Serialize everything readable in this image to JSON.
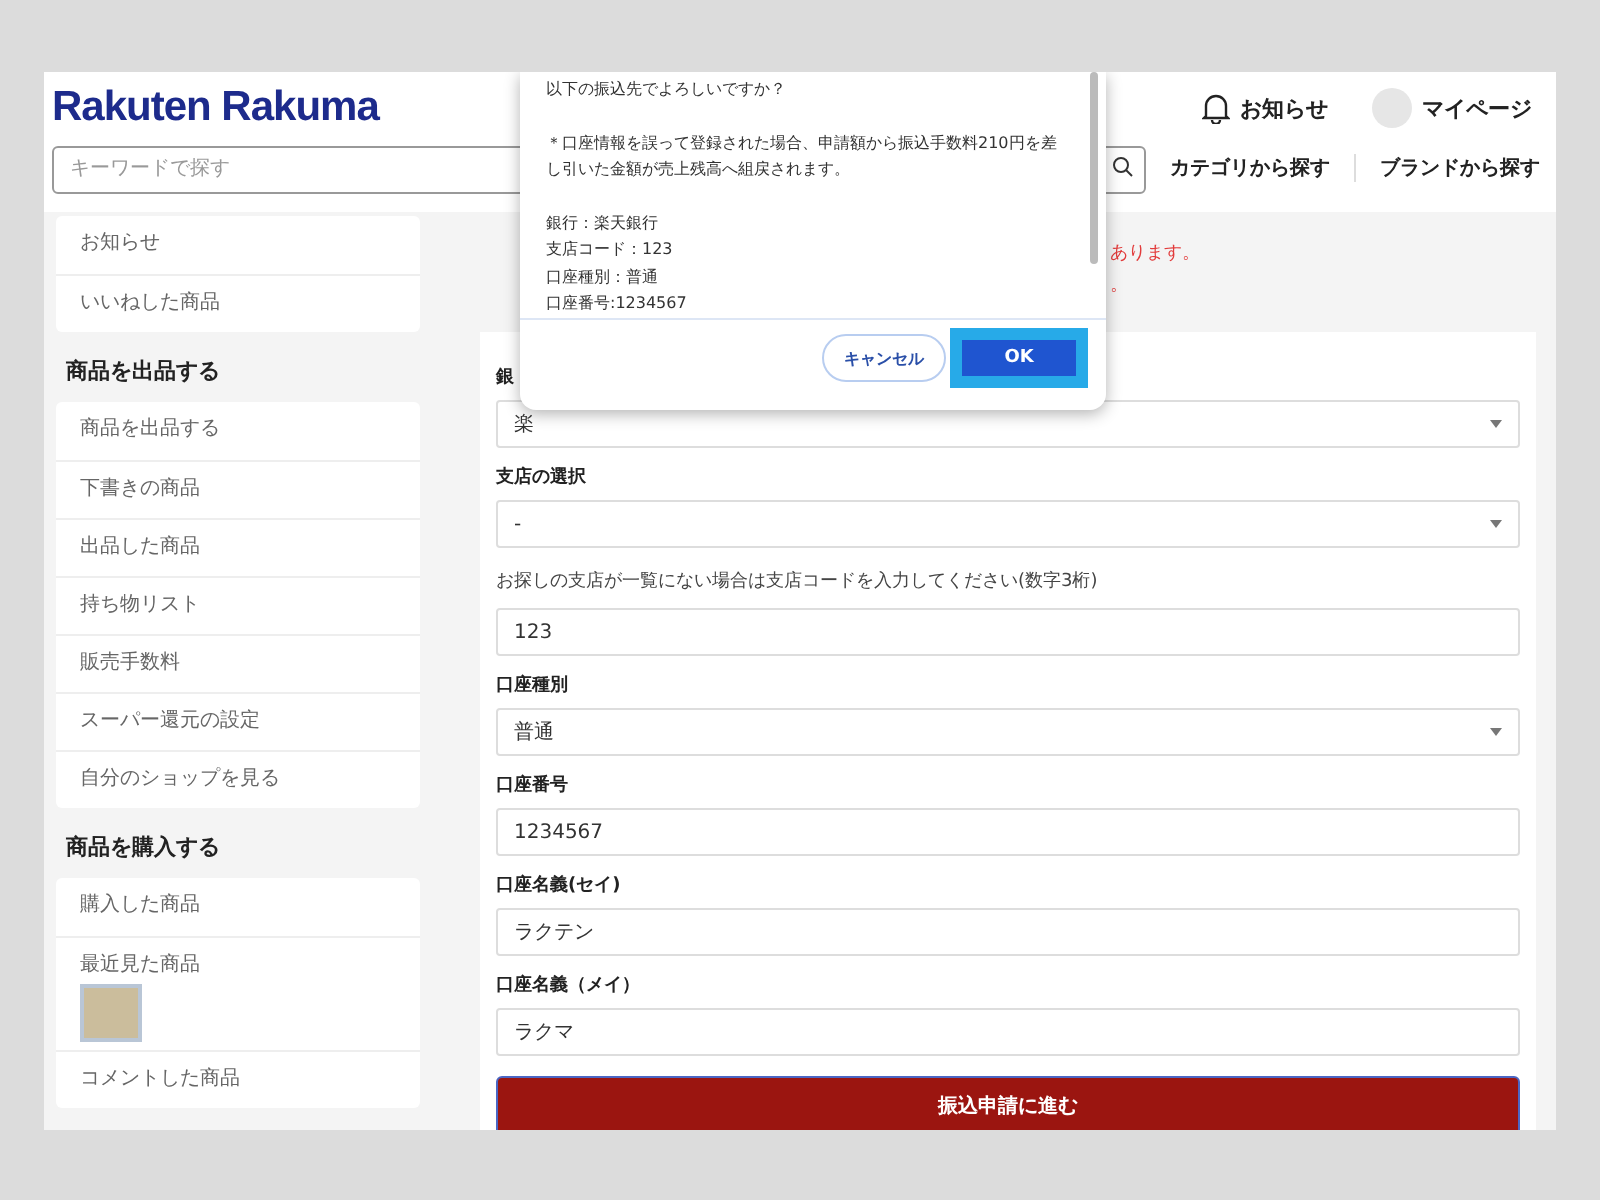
{
  "header": {
    "logo": "Rakuten Rakuma",
    "search": {
      "placeholder": "キーワードで探す"
    },
    "notifications": "お知らせ",
    "mypage": "マイページ",
    "links": [
      "カテゴリから探す",
      "ブランドから探す"
    ]
  },
  "sidebar": [
    {
      "items": [
        {
          "label": "お知らせ"
        },
        {
          "label": "いいねした商品"
        }
      ]
    },
    {
      "heading": "商品を出品する",
      "items": [
        {
          "label": "商品を出品する"
        },
        {
          "label": "下書きの商品"
        },
        {
          "label": "出品した商品"
        },
        {
          "label": "持ち物リスト"
        },
        {
          "label": "販売手数料"
        },
        {
          "label": "スーパー還元の設定"
        },
        {
          "label": "自分のショップを見る"
        }
      ]
    },
    {
      "heading": "商品を購入する",
      "items": [
        {
          "label": "購入した商品"
        },
        {
          "label": "最近見た商品",
          "kind": "thumbnail"
        },
        {
          "label": "コメントした商品"
        }
      ]
    }
  ],
  "notice": [
    "あります。",
    "。"
  ],
  "form": [
    {
      "kind": "select",
      "label": "銀",
      "value": "楽"
    },
    {
      "kind": "select",
      "label": "支店の選択",
      "value": "-"
    },
    {
      "kind": "input",
      "hint": "お探しの支店が一覧にない場合は支店コードを入力してください(数字3桁)",
      "value": "123"
    },
    {
      "kind": "select",
      "label": "口座種別",
      "value": "普通"
    },
    {
      "kind": "input",
      "label": "口座番号",
      "value": "1234567"
    },
    {
      "kind": "input",
      "label": "口座名義(セイ)",
      "value": "ラクテン"
    },
    {
      "kind": "input",
      "label": "口座名義（メイ）",
      "value": "ラクマ"
    }
  ],
  "submit": "振込申請に進む",
  "dialog": {
    "paragraphs": [
      [
        "以下の振込先でよろしいですか？"
      ],
      [
        "＊口座情報を誤って登録された場合、申請額から振込手数料210円を差し引いた金額が売上残高へ組戻されます。"
      ],
      [
        "銀行：楽天銀行",
        "支店コード：123",
        "口座種別：普通",
        "口座番号:1234567"
      ]
    ],
    "cancel": "キャンセル",
    "ok": "OK"
  }
}
